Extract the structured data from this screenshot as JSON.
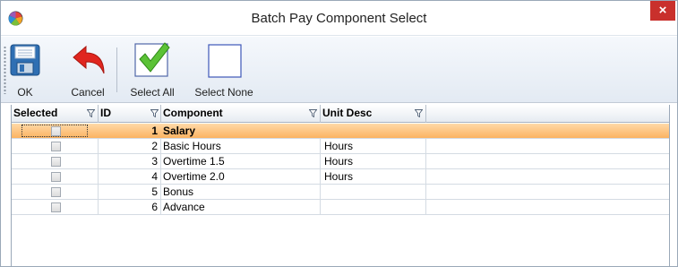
{
  "window": {
    "title": "Batch Pay Component Select",
    "close_symbol": "×",
    "accent_close": "#c9302c"
  },
  "toolbar": {
    "buttons": [
      {
        "label": "OK",
        "icon": "floppy-disk-icon"
      },
      {
        "label": "Cancel",
        "icon": "undo-arrow-icon"
      },
      {
        "label": "Select All",
        "icon": "checkmark-icon"
      },
      {
        "label": "Select None",
        "icon": "empty-square-icon"
      }
    ]
  },
  "grid": {
    "columns": [
      "Selected",
      "ID",
      "Component",
      "Unit Desc"
    ],
    "selected_row_color": "#fbb362",
    "rows": [
      {
        "selected": false,
        "id": "1",
        "component": "Salary",
        "unit_desc": ""
      },
      {
        "selected": false,
        "id": "2",
        "component": "Basic Hours",
        "unit_desc": "Hours"
      },
      {
        "selected": false,
        "id": "3",
        "component": "Overtime 1.5",
        "unit_desc": "Hours"
      },
      {
        "selected": false,
        "id": "4",
        "component": "Overtime 2.0",
        "unit_desc": "Hours"
      },
      {
        "selected": false,
        "id": "5",
        "component": "Bonus",
        "unit_desc": ""
      },
      {
        "selected": false,
        "id": "6",
        "component": "Advance",
        "unit_desc": ""
      }
    ]
  }
}
